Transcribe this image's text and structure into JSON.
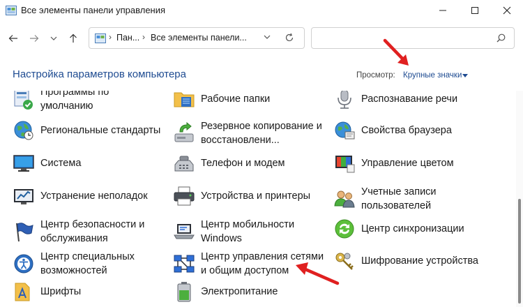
{
  "window": {
    "title": "Все элементы панели управления"
  },
  "address": {
    "crumb1": "Пан...",
    "crumb2": "Все элементы панели...",
    "search_placeholder": ""
  },
  "header": {
    "title": "Настройка параметров компьютера",
    "view_label": "Просмотр:",
    "view_value": "Крупные значки"
  },
  "items": [
    {
      "icon": "default-programs-icon",
      "label_lines": [
        "Программы по",
        "умолчанию"
      ]
    },
    {
      "icon": "work-folders-icon",
      "label_lines": [
        "Рабочие папки"
      ]
    },
    {
      "icon": "speech-recognition-icon",
      "label_lines": [
        "Распознавание речи"
      ]
    },
    {
      "icon": "region-icon",
      "label_lines": [
        "Региональные стандарты"
      ]
    },
    {
      "icon": "backup-restore-icon",
      "label_lines": [
        "Резервное копирование и",
        "восстановлени..."
      ]
    },
    {
      "icon": "internet-options-icon",
      "label_lines": [
        "Свойства браузера"
      ]
    },
    {
      "icon": "system-icon",
      "label_lines": [
        "Система"
      ]
    },
    {
      "icon": "phone-modem-icon",
      "label_lines": [
        "Телефон и модем"
      ]
    },
    {
      "icon": "color-management-icon",
      "label_lines": [
        "Управление цветом"
      ]
    },
    {
      "icon": "troubleshooting-icon",
      "label_lines": [
        "Устранение неполадок"
      ]
    },
    {
      "icon": "devices-printers-icon",
      "label_lines": [
        "Устройства и принтеры"
      ]
    },
    {
      "icon": "user-accounts-icon",
      "label_lines": [
        "Учетные записи",
        "пользователей"
      ]
    },
    {
      "icon": "security-maintenance-icon",
      "label_lines": [
        "Центр безопасности и",
        "обслуживания"
      ]
    },
    {
      "icon": "mobility-center-icon",
      "label_lines": [
        "Центр мобильности",
        "Windows"
      ]
    },
    {
      "icon": "sync-center-icon",
      "label_lines": [
        "Центр синхронизации"
      ]
    },
    {
      "icon": "ease-of-access-icon",
      "label_lines": [
        "Центр специальных",
        "возможностей"
      ]
    },
    {
      "icon": "network-sharing-icon",
      "label_lines": [
        "Центр управления сетями",
        "и общим доступом"
      ]
    },
    {
      "icon": "device-encryption-icon",
      "label_lines": [
        "Шифрование устройства"
      ]
    },
    {
      "icon": "fonts-icon",
      "label_lines": [
        "Шрифты"
      ]
    },
    {
      "icon": "power-options-icon",
      "label_lines": [
        "Электропитание"
      ]
    }
  ],
  "colors": {
    "accent": "#1e4b91",
    "annotation_arrow": "#e02020"
  }
}
